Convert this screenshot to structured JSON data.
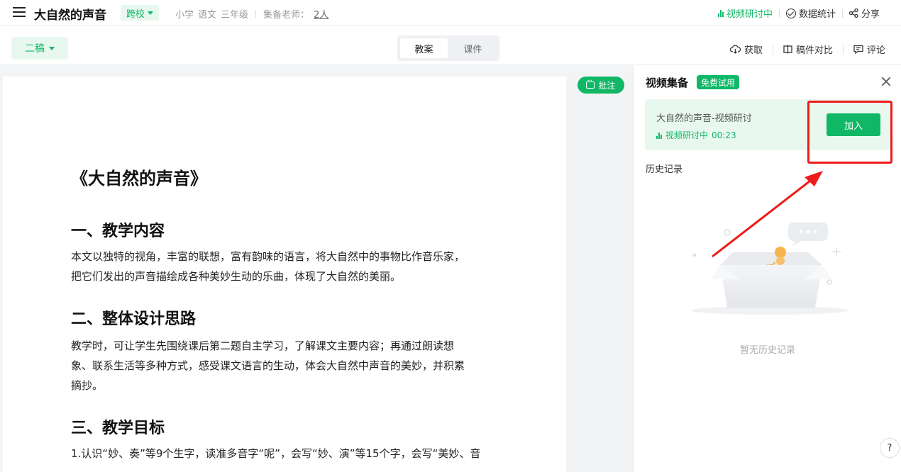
{
  "header": {
    "title": "大自然的声音",
    "scope_tag": "跨校",
    "meta_subject": [
      "小学",
      "语文",
      "三年级"
    ],
    "teachers_label": "集备老师：",
    "teachers_count": "2人",
    "live_label": "视频研讨中",
    "stats_label": "数据统计",
    "share_label": "分享"
  },
  "toolbar": {
    "draft_label": "二稿",
    "tabs": [
      {
        "label": "教案",
        "active": true
      },
      {
        "label": "课件",
        "active": false
      }
    ],
    "fetch_label": "获取",
    "compare_label": "稿件对比",
    "comment_label": "评论"
  },
  "document": {
    "title": "《大自然的声音》",
    "sections": [
      {
        "heading": "一、教学内容",
        "lines": [
          "本文以独特的视角，丰富的联想，富有韵味的语言，将大自然中的事物比作音乐家，",
          "把它们发出的声音描绘成各种美妙生动的乐曲，体现了大自然的美丽。"
        ]
      },
      {
        "heading": "二、整体设计思路",
        "lines": [
          "教学时，可让学生先围绕课后第二题自主学习，了解课文主要内容；再通过朗读想",
          "象、联系生活等多种方式，感受课文语言的生动，体会大自然中声音的美妙，并积累",
          "摘抄。"
        ]
      },
      {
        "heading": "三、教学目标",
        "lines": [
          "1.认识“妙、奏”等9个生字，读准多音字“呢”，会写“妙、演”等15个字，会写“美妙、音"
        ]
      }
    ]
  },
  "annotate_label": "批注",
  "panel": {
    "title": "视频集备",
    "badge": "免费试用",
    "live_card": {
      "name": "大自然的声音-视频研讨",
      "status": "视频研讨中",
      "timer": "00:23",
      "join_label": "加入"
    },
    "history_label": "历史记录",
    "empty_text": "暂无历史记录"
  },
  "help_glyph": "?",
  "colors": {
    "accent": "#10b866",
    "accent_bg": "#e8f8ef",
    "annotation_red": "#ee1c1c"
  }
}
